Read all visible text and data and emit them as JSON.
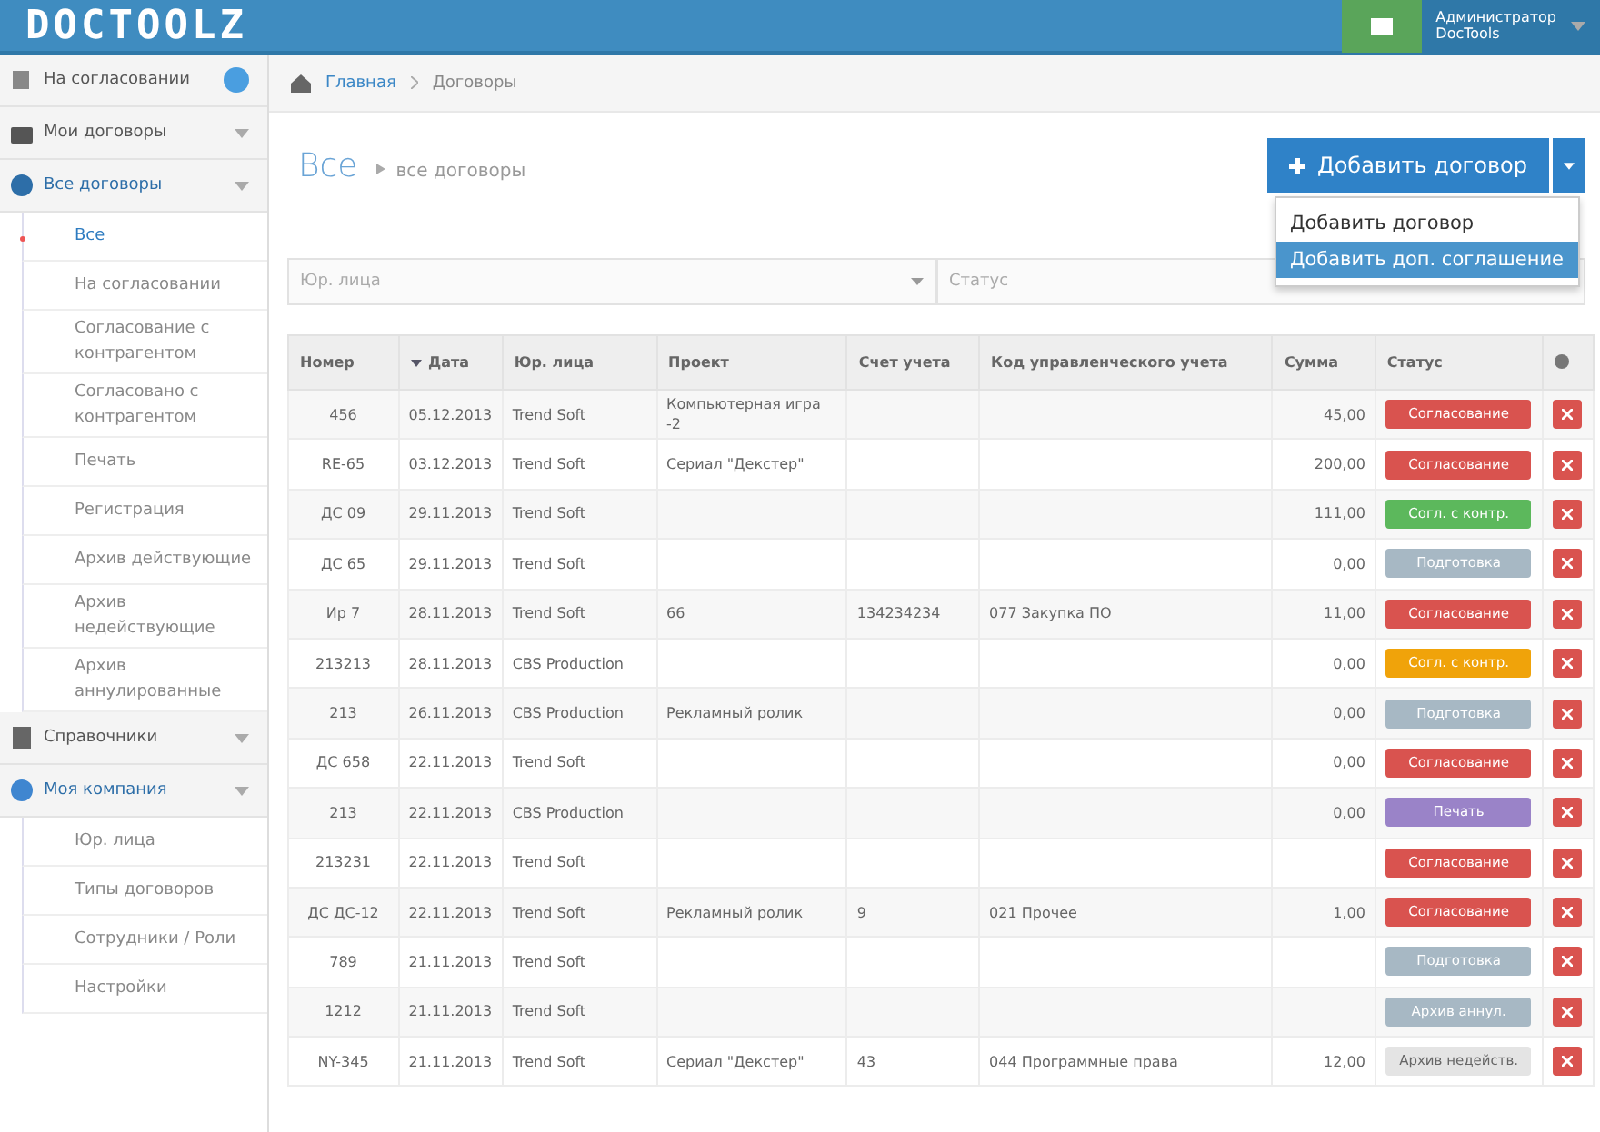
{
  "header": {
    "logo": "DOCTOOLZ",
    "user": {
      "role": "Администратор",
      "company": "DocTools"
    }
  },
  "sidebar": {
    "items": [
      {
        "label": "На согласовании",
        "expanded": false,
        "badge_dot": true
      },
      {
        "label": "Мои договоры",
        "expanded": false
      },
      {
        "label": "Все договоры",
        "expanded": true,
        "children": [
          {
            "label": "Все",
            "selected": true
          },
          {
            "label": "На согласовании",
            "selected": false
          },
          {
            "label": "Согласование с контрагентом",
            "selected": false
          },
          {
            "label": "Согласовано с контрагентом",
            "selected": false
          },
          {
            "label": "Печать",
            "selected": false
          },
          {
            "label": "Регистрация",
            "selected": false
          },
          {
            "label": "Архив действующие",
            "selected": false
          },
          {
            "label": "Архив недействующие",
            "selected": false
          },
          {
            "label": "Архив аннулированные",
            "selected": false
          }
        ]
      },
      {
        "label": "Справочники",
        "expanded": false
      },
      {
        "label": "Моя компания",
        "expanded": true,
        "children": [
          {
            "label": "Юр. лица",
            "selected": false
          },
          {
            "label": "Типы договоров",
            "selected": false
          },
          {
            "label": "Сотрудники / Роли",
            "selected": false
          },
          {
            "label": "Настройки",
            "selected": false
          }
        ]
      }
    ]
  },
  "breadcrumb": [
    "Главная",
    "Договоры"
  ],
  "page_title": {
    "title": "Все",
    "subtitle": "все договоры"
  },
  "add_button": {
    "label": "Добавить договор",
    "menu": [
      {
        "label": "Добавить договор",
        "selected": false
      },
      {
        "label": "Добавить доп. соглашение",
        "selected": true
      }
    ]
  },
  "filters": [
    {
      "placeholder": "Юр. лица"
    },
    {
      "placeholder": "Статус"
    }
  ],
  "table": {
    "columns": [
      {
        "label": "Номер",
        "sorted": false
      },
      {
        "label": "Дата",
        "sorted": true
      },
      {
        "label": "Юр. лица",
        "sorted": false
      },
      {
        "label": "Проект",
        "sorted": false
      },
      {
        "label": "Счет учета",
        "sorted": false
      },
      {
        "label": "Код управленческого учета",
        "sorted": false
      },
      {
        "label": "Сумма",
        "sorted": false
      },
      {
        "label": "Статус",
        "sorted": false
      }
    ],
    "rows": [
      {
        "cells": [
          "456",
          "05.12.2013",
          "Trend Soft",
          "Компьютерная игра -2",
          "",
          "",
          "45,00"
        ],
        "status": {
          "label": "Согласование",
          "color": "#d9534f"
        }
      },
      {
        "cells": [
          "RE-65",
          "03.12.2013",
          "Trend Soft",
          "Сериал \"Декстер\"",
          "",
          "",
          "200,00"
        ],
        "status": {
          "label": "Согласование",
          "color": "#d9534f"
        }
      },
      {
        "cells": [
          "ДС 09",
          "29.11.2013",
          "Trend Soft",
          "",
          "",
          "",
          "111,00"
        ],
        "status": {
          "label": "Согл. с контр.",
          "color": "#5cb85c"
        }
      },
      {
        "cells": [
          "ДС 65",
          "29.11.2013",
          "Trend Soft",
          "",
          "",
          "",
          "0,00"
        ],
        "status": {
          "label": "Подготовка",
          "color": "#a7b8c4"
        }
      },
      {
        "cells": [
          "Ир 7",
          "28.11.2013",
          "Trend Soft",
          "66",
          "134234234",
          "077 Закупка ПО",
          "11,00"
        ],
        "status": {
          "label": "Согласование",
          "color": "#d9534f"
        }
      },
      {
        "cells": [
          "213213",
          "28.11.2013",
          "CBS Production",
          "",
          "",
          "",
          "0,00"
        ],
        "status": {
          "label": "Согл. с контр.",
          "color": "#f0a30a"
        }
      },
      {
        "cells": [
          "213",
          "26.11.2013",
          "CBS Production",
          "Рекламный ролик",
          "",
          "",
          "0,00"
        ],
        "status": {
          "label": "Подготовка",
          "color": "#a7b8c4"
        }
      },
      {
        "cells": [
          "ДС 658",
          "22.11.2013",
          "Trend Soft",
          "",
          "",
          "",
          "0,00"
        ],
        "status": {
          "label": "Согласование",
          "color": "#d9534f"
        }
      },
      {
        "cells": [
          "213",
          "22.11.2013",
          "CBS Production",
          "",
          "",
          "",
          "0,00"
        ],
        "status": {
          "label": "Печать",
          "color": "#9a83c8"
        }
      },
      {
        "cells": [
          "213231",
          "22.11.2013",
          "Trend Soft",
          "",
          "",
          "",
          ""
        ],
        "status": {
          "label": "Согласование",
          "color": "#d9534f"
        }
      },
      {
        "cells": [
          "ДС ДС-12",
          "22.11.2013",
          "Trend Soft",
          "Рекламный ролик",
          "9",
          "021 Прочее",
          "1,00"
        ],
        "status": {
          "label": "Согласование",
          "color": "#d9534f"
        }
      },
      {
        "cells": [
          "789",
          "21.11.2013",
          "Trend Soft",
          "",
          "",
          "",
          ""
        ],
        "status": {
          "label": "Подготовка",
          "color": "#a7b8c4"
        }
      },
      {
        "cells": [
          "1212",
          "21.11.2013",
          "Trend Soft",
          "",
          "",
          "",
          ""
        ],
        "status": {
          "label": "Архив аннул.",
          "color": "#a7b8c4"
        }
      },
      {
        "cells": [
          "NY-345",
          "21.11.2013",
          "Trend Soft",
          "Сериал \"Декстер\"",
          "43",
          "044 Программные права",
          "12,00"
        ],
        "status": {
          "label": "Архив недейств.",
          "color": "#e4e4e4"
        }
      }
    ]
  }
}
